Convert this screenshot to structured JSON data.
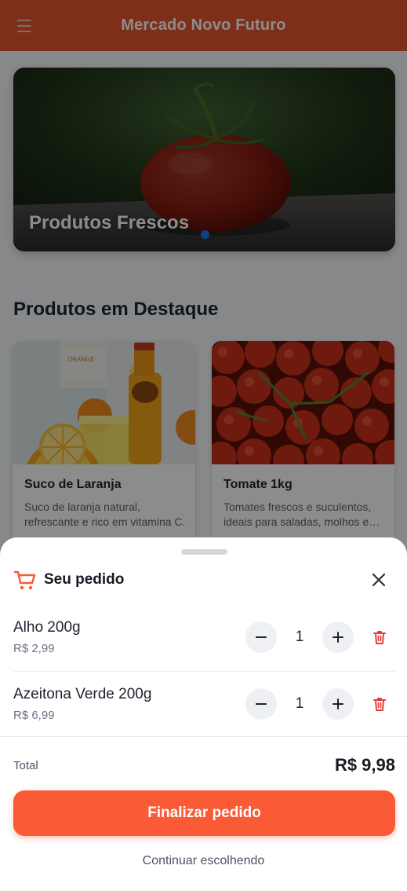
{
  "header": {
    "title": "Mercado Novo Futuro",
    "menu_icon": "hamburger-menu-icon",
    "color": "#e4572e"
  },
  "hero": {
    "title": "Produtos Frescos",
    "active_slide": 1,
    "dot_color": "#1a73e8"
  },
  "featured": {
    "title": "Produtos em Destaque",
    "products": [
      {
        "name": "Suco de Laranja",
        "description": "Suco de laranja natural, refrescante e rico em vitamina C."
      },
      {
        "name": "Tomate 1kg",
        "description": "Tomates frescos e suculentos, ideais para saladas, molhos e mais."
      }
    ]
  },
  "cart": {
    "title": "Seu pedido",
    "cart_icon": "shopping-cart-icon",
    "close_icon": "close-icon",
    "items": [
      {
        "name": "Alho 200g",
        "price": "R$ 2,99",
        "quantity": "1"
      },
      {
        "name": "Azeitona Verde 200g",
        "price": "R$ 6,99",
        "quantity": "1"
      }
    ],
    "total_label": "Total",
    "total_value": "R$ 9,98",
    "checkout_label": "Finalizar pedido",
    "continue_label": "Continuar escolhendo",
    "accent_color": "#fa5a35",
    "delete_color": "#e53935"
  }
}
